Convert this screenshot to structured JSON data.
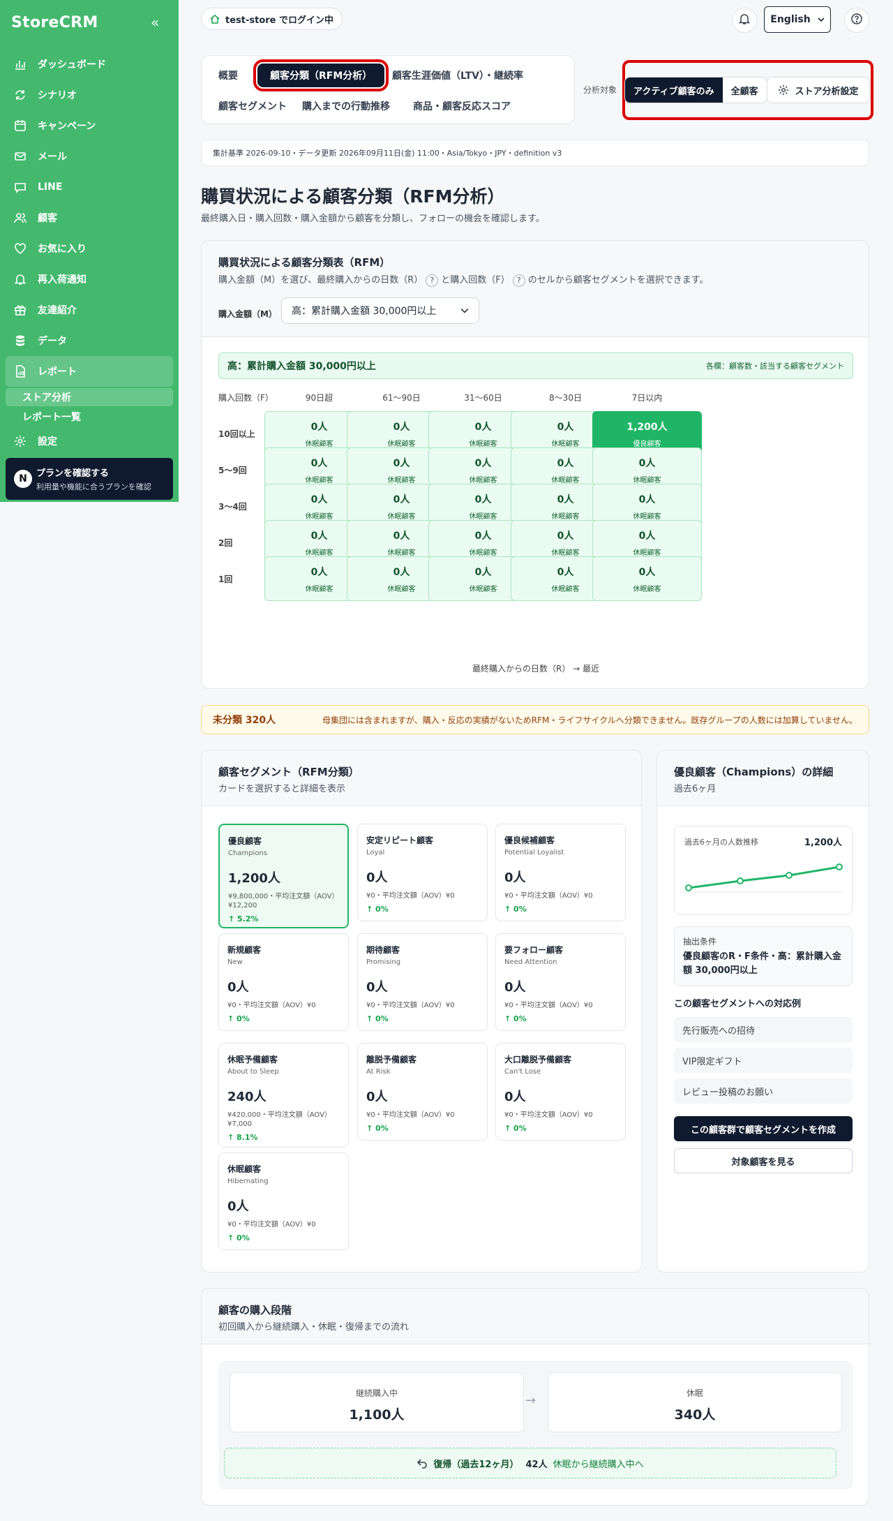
{
  "app": {
    "name": "StoreCRM",
    "login_status": "test-store でログイン中",
    "language": "English"
  },
  "sidebar": {
    "items": [
      {
        "label": "ダッシュボード",
        "icon": "chart-icon"
      },
      {
        "label": "シナリオ",
        "icon": "refresh-icon"
      },
      {
        "label": "キャンペーン",
        "icon": "calendar-icon"
      },
      {
        "label": "メール",
        "icon": "mail-icon"
      },
      {
        "label": "LINE",
        "icon": "chat-icon"
      },
      {
        "label": "顧客",
        "icon": "users-icon"
      },
      {
        "label": "お気に入り",
        "icon": "heart-icon"
      },
      {
        "label": "再入荷通知",
        "icon": "bell-icon"
      },
      {
        "label": "友達紹介",
        "icon": "gift-icon"
      },
      {
        "label": "データ",
        "icon": "database-icon"
      },
      {
        "label": "レポート",
        "icon": "report-icon"
      }
    ],
    "sub_items": [
      "ストア分析",
      "レポート一覧"
    ],
    "settings_label": "設定",
    "plan": {
      "badge": "N",
      "title": "プランを確認する",
      "desc": "利用量や機能に合うプランを確認"
    }
  },
  "tabs": [
    "概要",
    "顧客分類（RFM分析）",
    "顧客生涯価値（LTV）・継続率",
    "顧客セグメント",
    "購入までの行動推移",
    "商品・顧客反応スコア"
  ],
  "scope": {
    "label": "分析対象",
    "options": [
      "アクティブ顧客のみ",
      "全顧客"
    ],
    "settings": "ストア分析設定"
  },
  "meta": "集計基準 2026-09-10・データ更新 2026年09月11日(金) 11:00・Asia/Tokyo・JPY・definition v3",
  "page": {
    "title": "購買状況による顧客分類（RFM分析）",
    "desc": "最終購入日・購入回数・購入金額から顧客を分類し、フォローの機会を確認します。"
  },
  "rfm": {
    "title": "購買状況による顧客分類表（RFM）",
    "sub_a": "購入金額（M）を選び、最終購入からの日数（R）",
    "sub_b": "と購入回数（F）",
    "sub_c": "のセルから顧客セグメントを選択できます。",
    "help_mark": "?",
    "m_label": "購入金額（M）",
    "m_value": "高：累計購入金額 30,000円以上",
    "banner_left": "高：累計購入金額 30,000円以上",
    "banner_right": "各欄：顧客数・該当する顧客セグメント",
    "f_label": "購入回数（F）",
    "cols": [
      "90日超",
      "61〜90日",
      "31〜60日",
      "8〜30日",
      "7日以内"
    ],
    "rows": [
      {
        "label": "10回以上",
        "cells": [
          [
            "0人",
            "休眠顧客"
          ],
          [
            "0人",
            "休眠顧客"
          ],
          [
            "0人",
            "休眠顧客"
          ],
          [
            "0人",
            "休眠顧客"
          ],
          [
            "1,200人",
            "優良顧客"
          ]
        ]
      },
      {
        "label": "5〜9回",
        "cells": [
          [
            "0人",
            "休眠顧客"
          ],
          [
            "0人",
            "休眠顧客"
          ],
          [
            "0人",
            "休眠顧客"
          ],
          [
            "0人",
            "休眠顧客"
          ],
          [
            "0人",
            "休眠顧客"
          ]
        ]
      },
      {
        "label": "3〜4回",
        "cells": [
          [
            "0人",
            "休眠顧客"
          ],
          [
            "0人",
            "休眠顧客"
          ],
          [
            "0人",
            "休眠顧客"
          ],
          [
            "0人",
            "休眠顧客"
          ],
          [
            "0人",
            "休眠顧客"
          ]
        ]
      },
      {
        "label": "2回",
        "cells": [
          [
            "0人",
            "休眠顧客"
          ],
          [
            "0人",
            "休眠顧客"
          ],
          [
            "0人",
            "休眠顧客"
          ],
          [
            "0人",
            "休眠顧客"
          ],
          [
            "0人",
            "休眠顧客"
          ]
        ]
      },
      {
        "label": "1回",
        "cells": [
          [
            "0人",
            "休眠顧客"
          ],
          [
            "0人",
            "休眠顧客"
          ],
          [
            "0人",
            "休眠顧客"
          ],
          [
            "0人",
            "休眠顧客"
          ],
          [
            "0人",
            "休眠顧客"
          ]
        ]
      }
    ],
    "axis_note": "最終購入からの日数（R） → 最近"
  },
  "unclassified": {
    "label": "未分類 320人",
    "note": "母集団には含まれますが、購入・反応の実績がないためRFM・ライフサイクルへ分類できません。既存グループの人数には加算していません。"
  },
  "segments": {
    "title": "顧客セグメント（RFM分類）",
    "sub": "カードを選択すると詳細を表示",
    "cards": [
      {
        "name": "優良顧客",
        "en": "Champions",
        "count": "1,200人",
        "aov": "¥9,800,000・平均注文額（AOV）¥12,200",
        "change": "↑ 5.2%"
      },
      {
        "name": "安定リピート顧客",
        "en": "Loyal",
        "count": "0人",
        "aov": "¥0・平均注文額（AOV）¥0",
        "change": "↑ 0%"
      },
      {
        "name": "優良候補顧客",
        "en": "Potential Loyalist",
        "count": "0人",
        "aov": "¥0・平均注文額（AOV）¥0",
        "change": "↑ 0%"
      },
      {
        "name": "新規顧客",
        "en": "New",
        "count": "0人",
        "aov": "¥0・平均注文額（AOV）¥0",
        "change": "↑ 0%"
      },
      {
        "name": "期待顧客",
        "en": "Promising",
        "count": "0人",
        "aov": "¥0・平均注文額（AOV）¥0",
        "change": "↑ 0%"
      },
      {
        "name": "要フォロー顧客",
        "en": "Need Attention",
        "count": "0人",
        "aov": "¥0・平均注文額（AOV）¥0",
        "change": "↑ 0%"
      },
      {
        "name": "休眠予備顧客",
        "en": "About to Sleep",
        "count": "240人",
        "aov": "¥420,000・平均注文額（AOV）¥7,000",
        "change": "↑ 8.1%"
      },
      {
        "name": "離脱予備顧客",
        "en": "At Risk",
        "count": "0人",
        "aov": "¥0・平均注文額（AOV）¥0",
        "change": "↑ 0%"
      },
      {
        "name": "大口離脱予備顧客",
        "en": "Can't Lose",
        "count": "0人",
        "aov": "¥0・平均注文額（AOV）¥0",
        "change": "↑ 0%"
      },
      {
        "name": "休眠顧客",
        "en": "Hibernating",
        "count": "0人",
        "aov": "¥0・平均注文額（AOV）¥0",
        "change": "↑ 0%"
      }
    ]
  },
  "detail": {
    "title": "優良顧客（Champions）の詳細",
    "sub": "過去6ヶ月",
    "trend_label": "過去6ヶ月の人数推移",
    "trend_value": "1,200人",
    "cond_label": "抽出条件",
    "cond_value": "優良顧客のR・F条件・高：累計購入金額 30,000円以上",
    "actions_title": "この顧客セグメントへの対応例",
    "actions": [
      "先行販売への招待",
      "VIP限定ギフト",
      "レビュー投稿のお願い"
    ],
    "primary_button": "この顧客群で顧客セグメントを作成",
    "secondary_button": "対象顧客を見る"
  },
  "stages": {
    "title": "顧客の購入段階",
    "sub": "初回購入から継続購入・休眠・復帰までの流れ",
    "boxes": [
      {
        "label": "継続購入中",
        "value": "1,100人"
      },
      {
        "label": "休眠",
        "value": "340人"
      }
    ],
    "return_label": "復帰（過去12ヶ月）",
    "return_count": "42人",
    "return_desc": "休眠から継続購入中へ"
  }
}
